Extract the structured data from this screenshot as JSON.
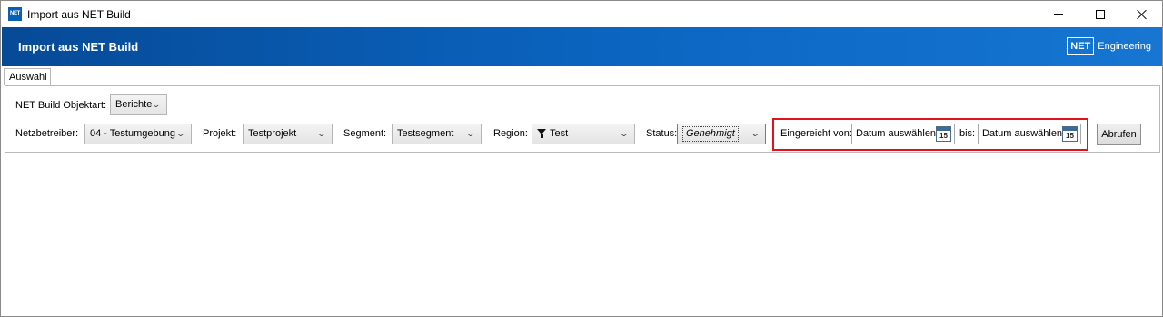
{
  "window": {
    "title": "Import aus NET Build",
    "icon_text": "NET"
  },
  "header": {
    "title": "Import aus NET Build",
    "brand_box": "NET",
    "brand_text": "Engineering"
  },
  "tabs": [
    {
      "label": "Auswahl",
      "selected": true
    }
  ],
  "filters": {
    "objektart_label": "NET Build Objektart:",
    "objektart_value": "Berichte",
    "netzbetreiber_label": "Netzbetreiber:",
    "netzbetreiber_value": "04 - Testumgebung",
    "projekt_label": "Projekt:",
    "projekt_value": "Testprojekt",
    "segment_label": "Segment:",
    "segment_value": "Testsegment",
    "region_label": "Region:",
    "region_value": "Test",
    "status_label": "Status:",
    "status_value": "Genehmigt",
    "eingereicht_label": "Eingereicht von:",
    "date_from_placeholder": "Datum auswählen",
    "bis_label": "bis:",
    "date_to_placeholder": "Datum auswählen",
    "calendar_day": "15",
    "fetch_button": "Abrufen"
  },
  "colors": {
    "banner": "#0b66c2",
    "highlight": "#e0131d"
  },
  "icons": {
    "calendar": "calendar-icon",
    "filter": "filter-icon",
    "chevron": "chevron-down-icon"
  }
}
